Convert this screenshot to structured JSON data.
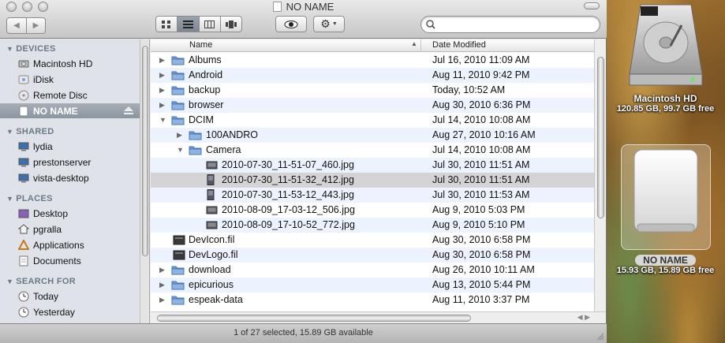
{
  "window": {
    "title": "NO NAME",
    "status_text": "1 of 27 selected, 15.89 GB available"
  },
  "toolbar": {
    "back_icon": "back-arrow-icon",
    "forward_icon": "forward-arrow-icon",
    "view_modes": [
      "icon-view",
      "list-view",
      "column-view",
      "coverflow-view"
    ],
    "active_view": "list-view",
    "search": {
      "value": "",
      "placeholder": ""
    }
  },
  "sidebar": {
    "sections": [
      {
        "header": "DEVICES",
        "items": [
          {
            "label": "Macintosh HD",
            "icon": "hard-drive-icon"
          },
          {
            "label": "iDisk",
            "icon": "idisk-icon"
          },
          {
            "label": "Remote Disc",
            "icon": "remote-disc-icon"
          },
          {
            "label": "NO NAME",
            "icon": "removable-drive-icon",
            "selected": true
          }
        ]
      },
      {
        "header": "SHARED",
        "items": [
          {
            "label": "lydia",
            "icon": "network-computer-icon"
          },
          {
            "label": "prestonserver",
            "icon": "network-computer-icon"
          },
          {
            "label": "vista-desktop",
            "icon": "network-computer-icon"
          }
        ]
      },
      {
        "header": "PLACES",
        "items": [
          {
            "label": "Desktop",
            "icon": "desktop-icon"
          },
          {
            "label": "pgralla",
            "icon": "home-icon"
          },
          {
            "label": "Applications",
            "icon": "applications-icon"
          },
          {
            "label": "Documents",
            "icon": "documents-icon"
          }
        ]
      },
      {
        "header": "SEARCH FOR",
        "items": [
          {
            "label": "Today",
            "icon": "clock-icon"
          },
          {
            "label": "Yesterday",
            "icon": "clock-icon"
          }
        ]
      }
    ]
  },
  "list": {
    "columns": {
      "name": "Name",
      "date": "Date Modified"
    },
    "rows": [
      {
        "name": "Albums",
        "date": "Jul 16, 2010 11:09 AM",
        "kind": "folder",
        "level": 0,
        "expanded": false
      },
      {
        "name": "Android",
        "date": "Aug 11, 2010 9:42 PM",
        "kind": "folder",
        "level": 0,
        "expanded": false
      },
      {
        "name": "backup",
        "date": "Today, 10:52 AM",
        "kind": "folder",
        "level": 0,
        "expanded": false
      },
      {
        "name": "browser",
        "date": "Aug 30, 2010 6:36 PM",
        "kind": "folder",
        "level": 0,
        "expanded": false
      },
      {
        "name": "DCIM",
        "date": "Jul 14, 2010 10:08 AM",
        "kind": "folder",
        "level": 0,
        "expanded": true
      },
      {
        "name": "100ANDRO",
        "date": "Aug 27, 2010 10:16 AM",
        "kind": "folder",
        "level": 1,
        "expanded": false
      },
      {
        "name": "Camera",
        "date": "Jul 14, 2010 10:08 AM",
        "kind": "folder",
        "level": 1,
        "expanded": true
      },
      {
        "name": "2010-07-30_11-51-07_460.jpg",
        "date": "Jul 30, 2010 11:51 AM",
        "kind": "image",
        "level": 2
      },
      {
        "name": "2010-07-30_11-51-32_412.jpg",
        "date": "Jul 30, 2010 11:51 AM",
        "kind": "image-portrait",
        "level": 2,
        "selected": true
      },
      {
        "name": "2010-07-30_11-53-12_443.jpg",
        "date": "Jul 30, 2010 11:53 AM",
        "kind": "image-portrait",
        "level": 2
      },
      {
        "name": "2010-08-09_17-03-12_506.jpg",
        "date": "Aug 9, 2010 5:03 PM",
        "kind": "image",
        "level": 2
      },
      {
        "name": "2010-08-09_17-10-52_772.jpg",
        "date": "Aug 9, 2010 5:10 PM",
        "kind": "image",
        "level": 2
      },
      {
        "name": "DevIcon.fil",
        "date": "Aug 30, 2010 6:58 PM",
        "kind": "file",
        "level": 0
      },
      {
        "name": "DevLogo.fil",
        "date": "Aug 30, 2010 6:58 PM",
        "kind": "file",
        "level": 0
      },
      {
        "name": "download",
        "date": "Aug 26, 2010 10:11 AM",
        "kind": "folder",
        "level": 0,
        "expanded": false
      },
      {
        "name": "epicurious",
        "date": "Aug 13, 2010 5:44 PM",
        "kind": "folder",
        "level": 0,
        "expanded": false
      },
      {
        "name": "espeak-data",
        "date": "Aug 11, 2010 3:37 PM",
        "kind": "folder",
        "level": 0,
        "expanded": false
      }
    ]
  },
  "desktop": {
    "macintosh_hd": {
      "label": "Macintosh HD",
      "info": "120.85 GB, 99.7 GB free"
    },
    "no_name": {
      "label": "NO NAME",
      "info": "15.93 GB, 15.89 GB free"
    }
  },
  "colors": {
    "selection_row": "#d4d4d4",
    "alt_row": "#edf3fe",
    "sidebar_bg": "#dfe3e9",
    "sidebar_header": "#6d7886",
    "folder_blue": "#6f9bd3"
  }
}
